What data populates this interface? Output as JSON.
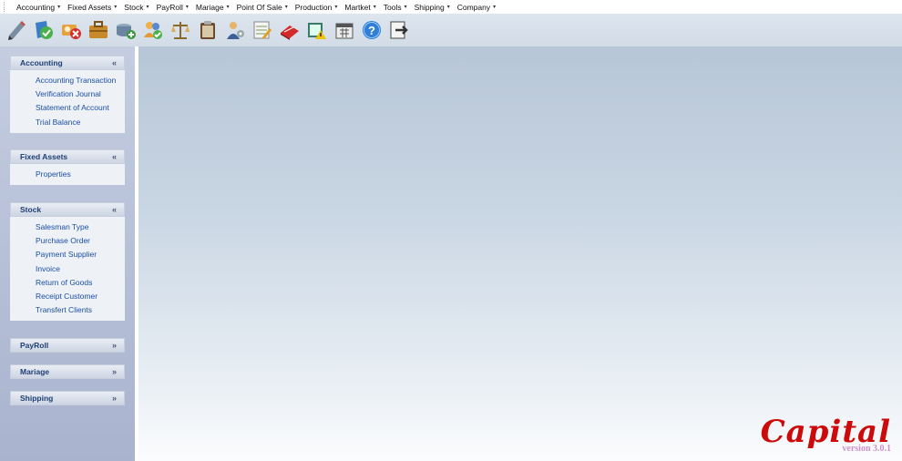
{
  "menubar": {
    "items": [
      {
        "label": "Accounting"
      },
      {
        "label": "Fixed Assets"
      },
      {
        "label": "Stock"
      },
      {
        "label": "PayRoll"
      },
      {
        "label": "Mariage"
      },
      {
        "label": "Point Of Sale"
      },
      {
        "label": "Production"
      },
      {
        "label": "Martket"
      },
      {
        "label": "Tools"
      },
      {
        "label": "Shipping"
      },
      {
        "label": "Company"
      }
    ],
    "arrow": "▾"
  },
  "toolbar": {
    "icons": [
      "pen-icon",
      "shield-check-icon",
      "contacts-delete-icon",
      "briefcase-icon",
      "stack-add-icon",
      "users-check-icon",
      "scales-icon",
      "clipboard-icon",
      "user-gear-icon",
      "calculator-sheet-icon",
      "eraser-icon",
      "chart-warning-icon",
      "calendar-icon",
      "help-icon",
      "export-icon"
    ]
  },
  "sidebar": {
    "groups": [
      {
        "title": "Accounting",
        "toggle": "«",
        "expanded": true,
        "links": [
          "Accounting Transaction",
          "Verification Journal",
          "Statement of Account",
          "Trial Balance"
        ]
      },
      {
        "title": "Fixed Assets",
        "toggle": "«",
        "expanded": true,
        "links": [
          "Properties"
        ]
      },
      {
        "title": "Stock",
        "toggle": "«",
        "expanded": true,
        "links": [
          "Salesman Type",
          "Purchase Order",
          "Payment Supplier",
          "Invoice",
          "Return of Goods",
          "Receipt Customer",
          "Transfert Clients"
        ]
      },
      {
        "title": "PayRoll",
        "toggle": "»",
        "expanded": false,
        "links": []
      },
      {
        "title": "Mariage",
        "toggle": "»",
        "expanded": false,
        "links": []
      },
      {
        "title": "Shipping",
        "toggle": "»",
        "expanded": false,
        "links": []
      }
    ]
  },
  "brand": {
    "name": "Capital",
    "version": "version 3.0.1",
    "color": "#cc0a0a"
  }
}
